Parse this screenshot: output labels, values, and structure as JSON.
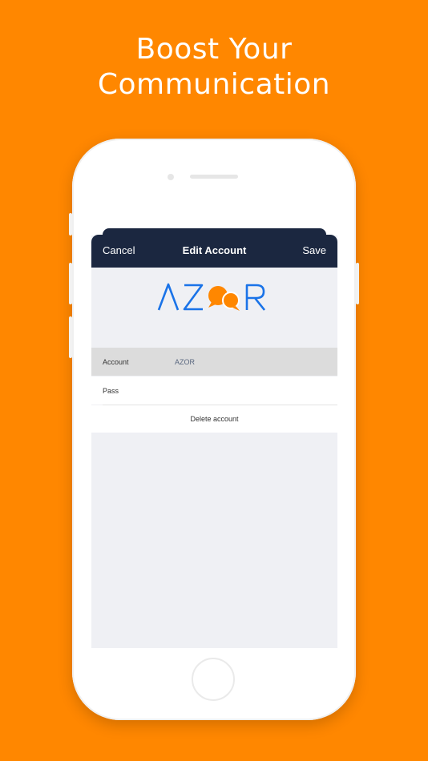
{
  "headline": {
    "line1": "Boost Your",
    "line2": "Communication"
  },
  "navbar": {
    "cancel": "Cancel",
    "title": "Edit Account",
    "save": "Save"
  },
  "logo": {
    "text": "AZOR",
    "colors": {
      "letters": "#1A73E8",
      "bubble": "#FF8700"
    }
  },
  "form": {
    "account_label": "Account",
    "account_value": "AZOR",
    "pass_label": "Pass",
    "pass_value": "",
    "delete_label": "Delete account"
  },
  "colors": {
    "background": "#FF8700",
    "navbar": "#1B2740",
    "screen": "#EFF0F4"
  }
}
